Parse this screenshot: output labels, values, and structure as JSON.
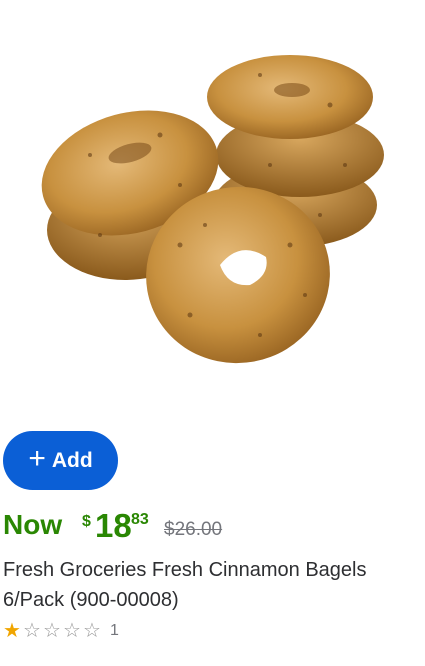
{
  "product": {
    "image_alt": "Fresh cinnamon bagels",
    "add_label": "Add",
    "price": {
      "now_label": "Now",
      "currency": "$",
      "dollars": "18",
      "cents": "83",
      "was": "$26.00"
    },
    "title": "Fresh Groceries Fresh Cinnamon Bagels 6/Pack (900-00008)",
    "rating": {
      "stars": 1,
      "max_stars": 5,
      "review_count": "1"
    }
  },
  "colors": {
    "accent": "#0b5fd6",
    "price_green": "#2a8703",
    "star": "#f0a500"
  }
}
